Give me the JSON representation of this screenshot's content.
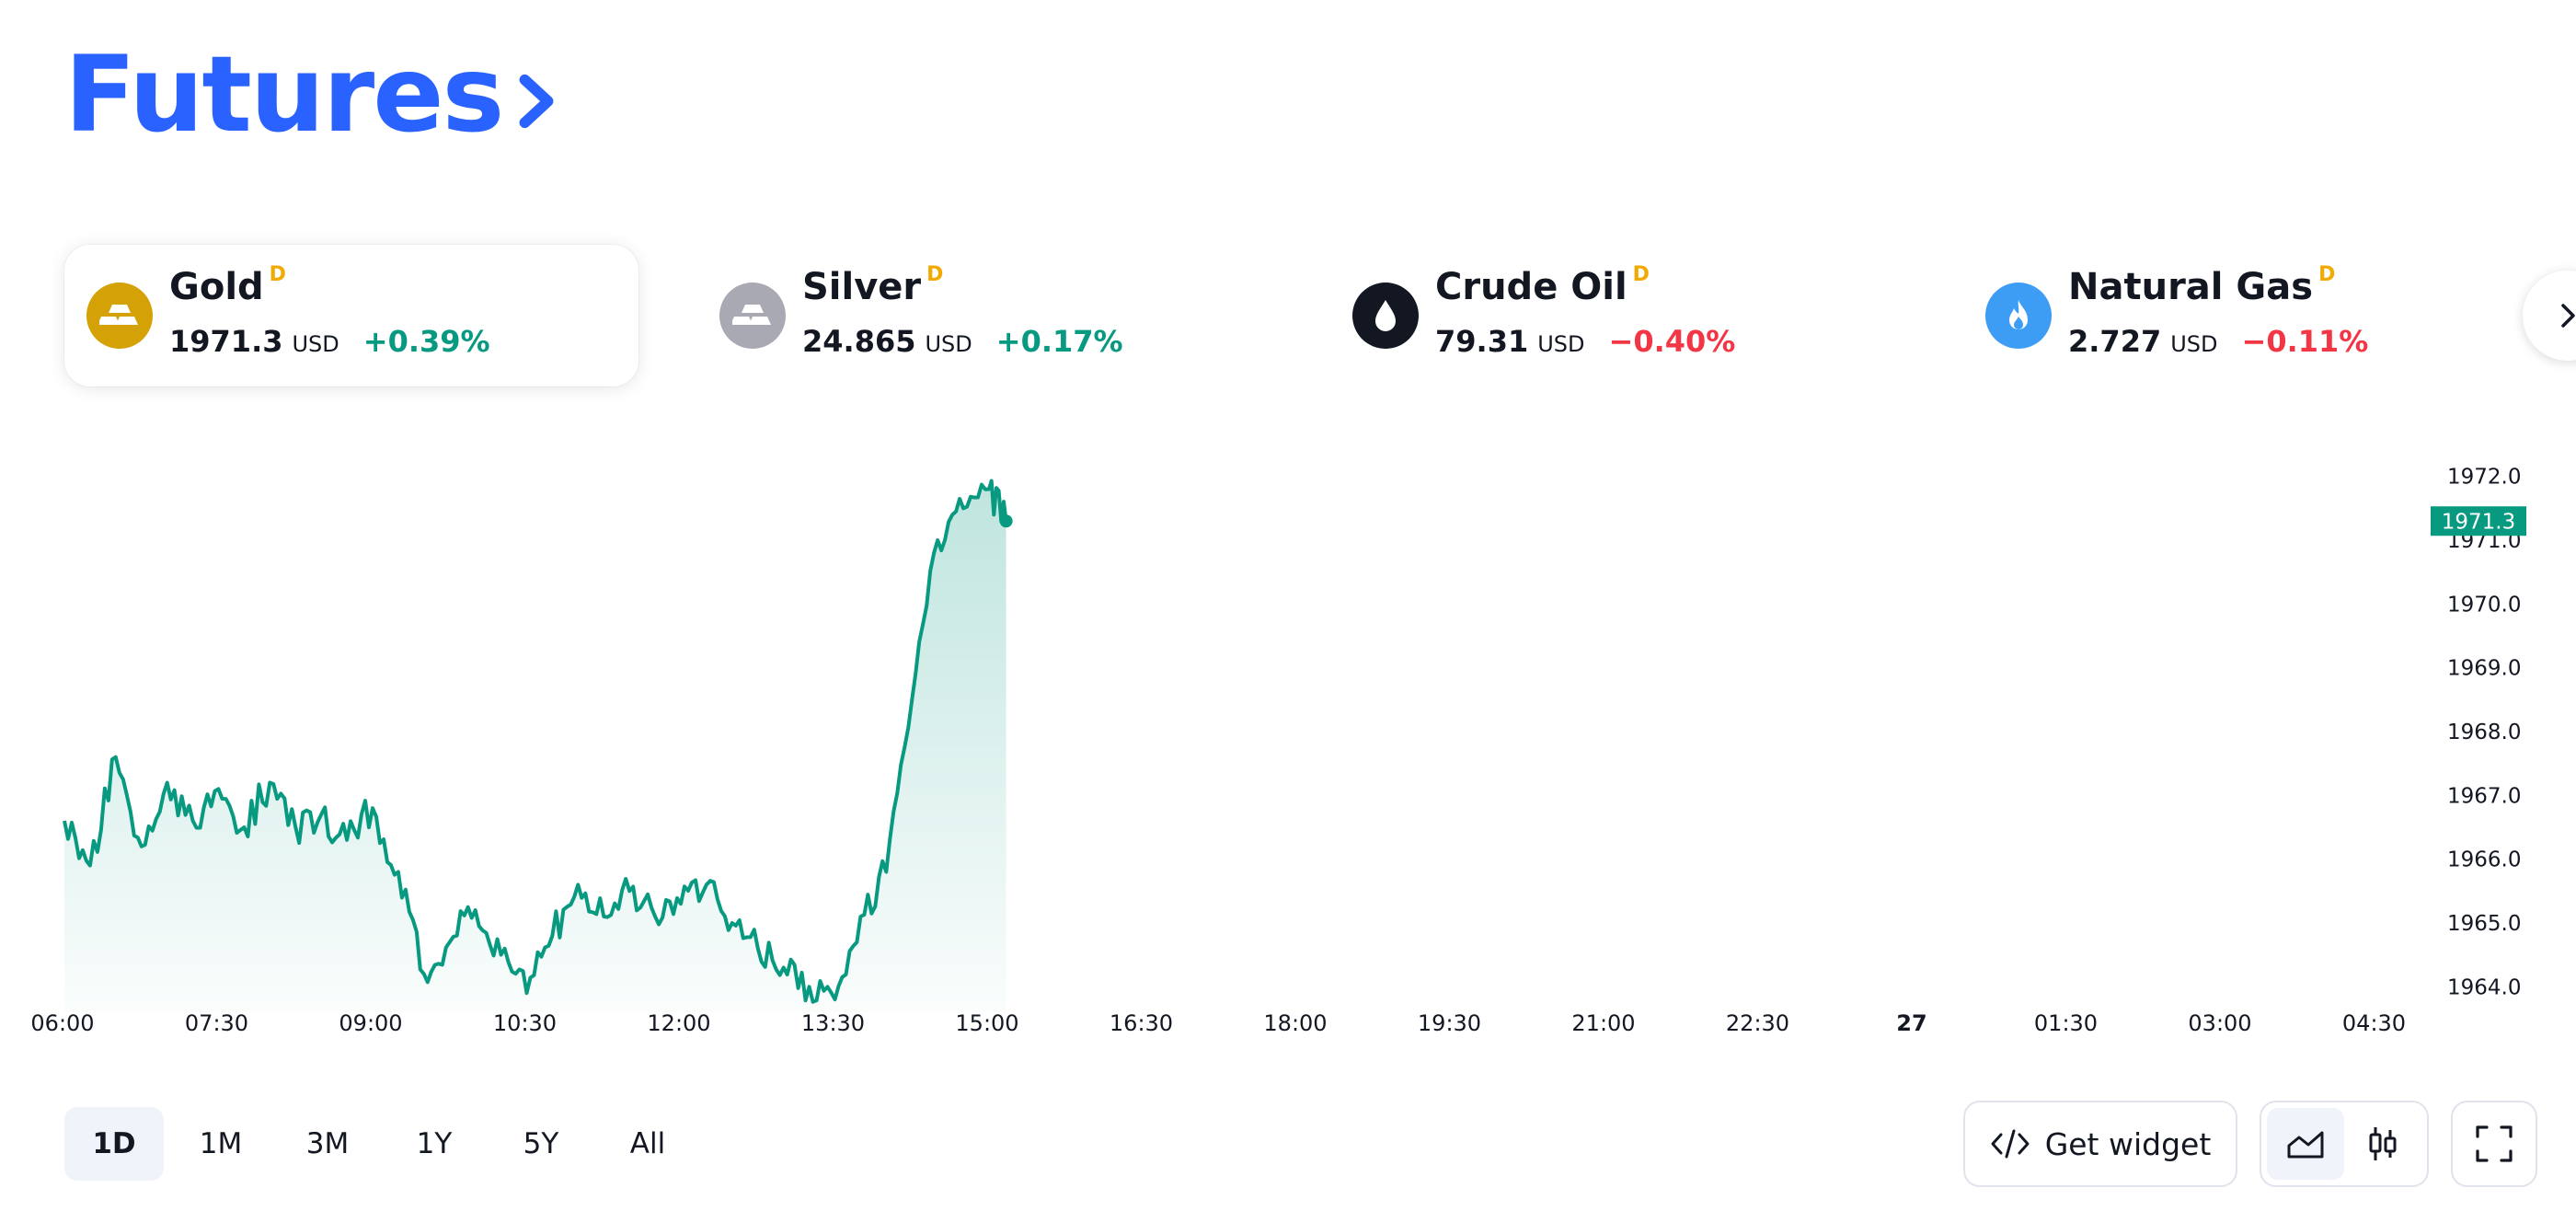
{
  "header": {
    "title": "Futures"
  },
  "tiles": [
    {
      "name": "Gold",
      "badge": "D",
      "price": "1971.3",
      "currency": "USD",
      "change": "+0.39%",
      "direction": "up",
      "icon": "gold-bars-icon",
      "icon_bg": "#d4a106"
    },
    {
      "name": "Silver",
      "badge": "D",
      "price": "24.865",
      "currency": "USD",
      "change": "+0.17%",
      "direction": "up",
      "icon": "silver-bars-icon",
      "icon_bg": "#a9a9b3"
    },
    {
      "name": "Crude Oil",
      "badge": "D",
      "price": "79.31",
      "currency": "USD",
      "change": "−0.40%",
      "direction": "down",
      "icon": "oil-drop-icon",
      "icon_bg": "#131722"
    },
    {
      "name": "Natural Gas",
      "badge": "D",
      "price": "2.727",
      "currency": "USD",
      "change": "−0.11%",
      "direction": "down",
      "icon": "flame-icon",
      "icon_bg": "#3d9df5"
    }
  ],
  "colors": {
    "accent": "#2962ff",
    "up": "#089981",
    "down": "#f23645",
    "badge": "#f2a900"
  },
  "chart_data": {
    "type": "area",
    "series": [
      {
        "x": [
          "06:00",
          "06:15",
          "06:30",
          "06:45",
          "07:00",
          "07:15",
          "07:30",
          "07:45",
          "08:00",
          "08:15",
          "08:30",
          "08:45",
          "09:00",
          "09:15",
          "09:30",
          "09:45",
          "10:00",
          "10:15",
          "10:30",
          "10:45",
          "11:00",
          "11:15",
          "11:30",
          "11:45",
          "12:00",
          "12:15",
          "12:30",
          "12:45",
          "13:00",
          "13:15",
          "13:30",
          "13:45",
          "14:00",
          "14:15",
          "14:30",
          "14:45",
          "15:00",
          "15:10"
        ],
        "values": [
          1966.6,
          1965.9,
          1967.6,
          1966.2,
          1967.2,
          1966.6,
          1967.1,
          1966.5,
          1967.2,
          1966.5,
          1966.7,
          1966.3,
          1966.8,
          1965.8,
          1964.2,
          1964.7,
          1965.2,
          1964.5,
          1963.9,
          1964.8,
          1965.6,
          1965.1,
          1965.5,
          1965.1,
          1965.3,
          1965.6,
          1965.0,
          1964.6,
          1964.3,
          1964.0,
          1963.8,
          1965.1,
          1965.8,
          1968.5,
          1971.0,
          1971.5,
          1971.8,
          1971.3
        ]
      }
    ],
    "last_value": "1971.3",
    "y_ticks": [
      "1972.0",
      "1971.0",
      "1970.0",
      "1969.0",
      "1968.0",
      "1967.0",
      "1966.0",
      "1965.0",
      "1964.0"
    ],
    "x_ticks": [
      {
        "label": "06:00"
      },
      {
        "label": "07:30"
      },
      {
        "label": "09:00"
      },
      {
        "label": "10:30"
      },
      {
        "label": "12:00"
      },
      {
        "label": "13:30"
      },
      {
        "label": "15:00"
      },
      {
        "label": "16:30"
      },
      {
        "label": "18:00"
      },
      {
        "label": "19:30"
      },
      {
        "label": "21:00"
      },
      {
        "label": "22:30"
      },
      {
        "label": "27",
        "bold": true
      },
      {
        "label": "01:30"
      },
      {
        "label": "03:00"
      },
      {
        "label": "04:30"
      }
    ],
    "ylim": [
      1963.6,
      1972.4
    ],
    "line_color": "#089981",
    "grid": false
  },
  "controls": {
    "ranges": [
      "1D",
      "1M",
      "3M",
      "1Y",
      "5Y",
      "All"
    ],
    "active_range": "1D",
    "widget_label": "Get widget"
  }
}
